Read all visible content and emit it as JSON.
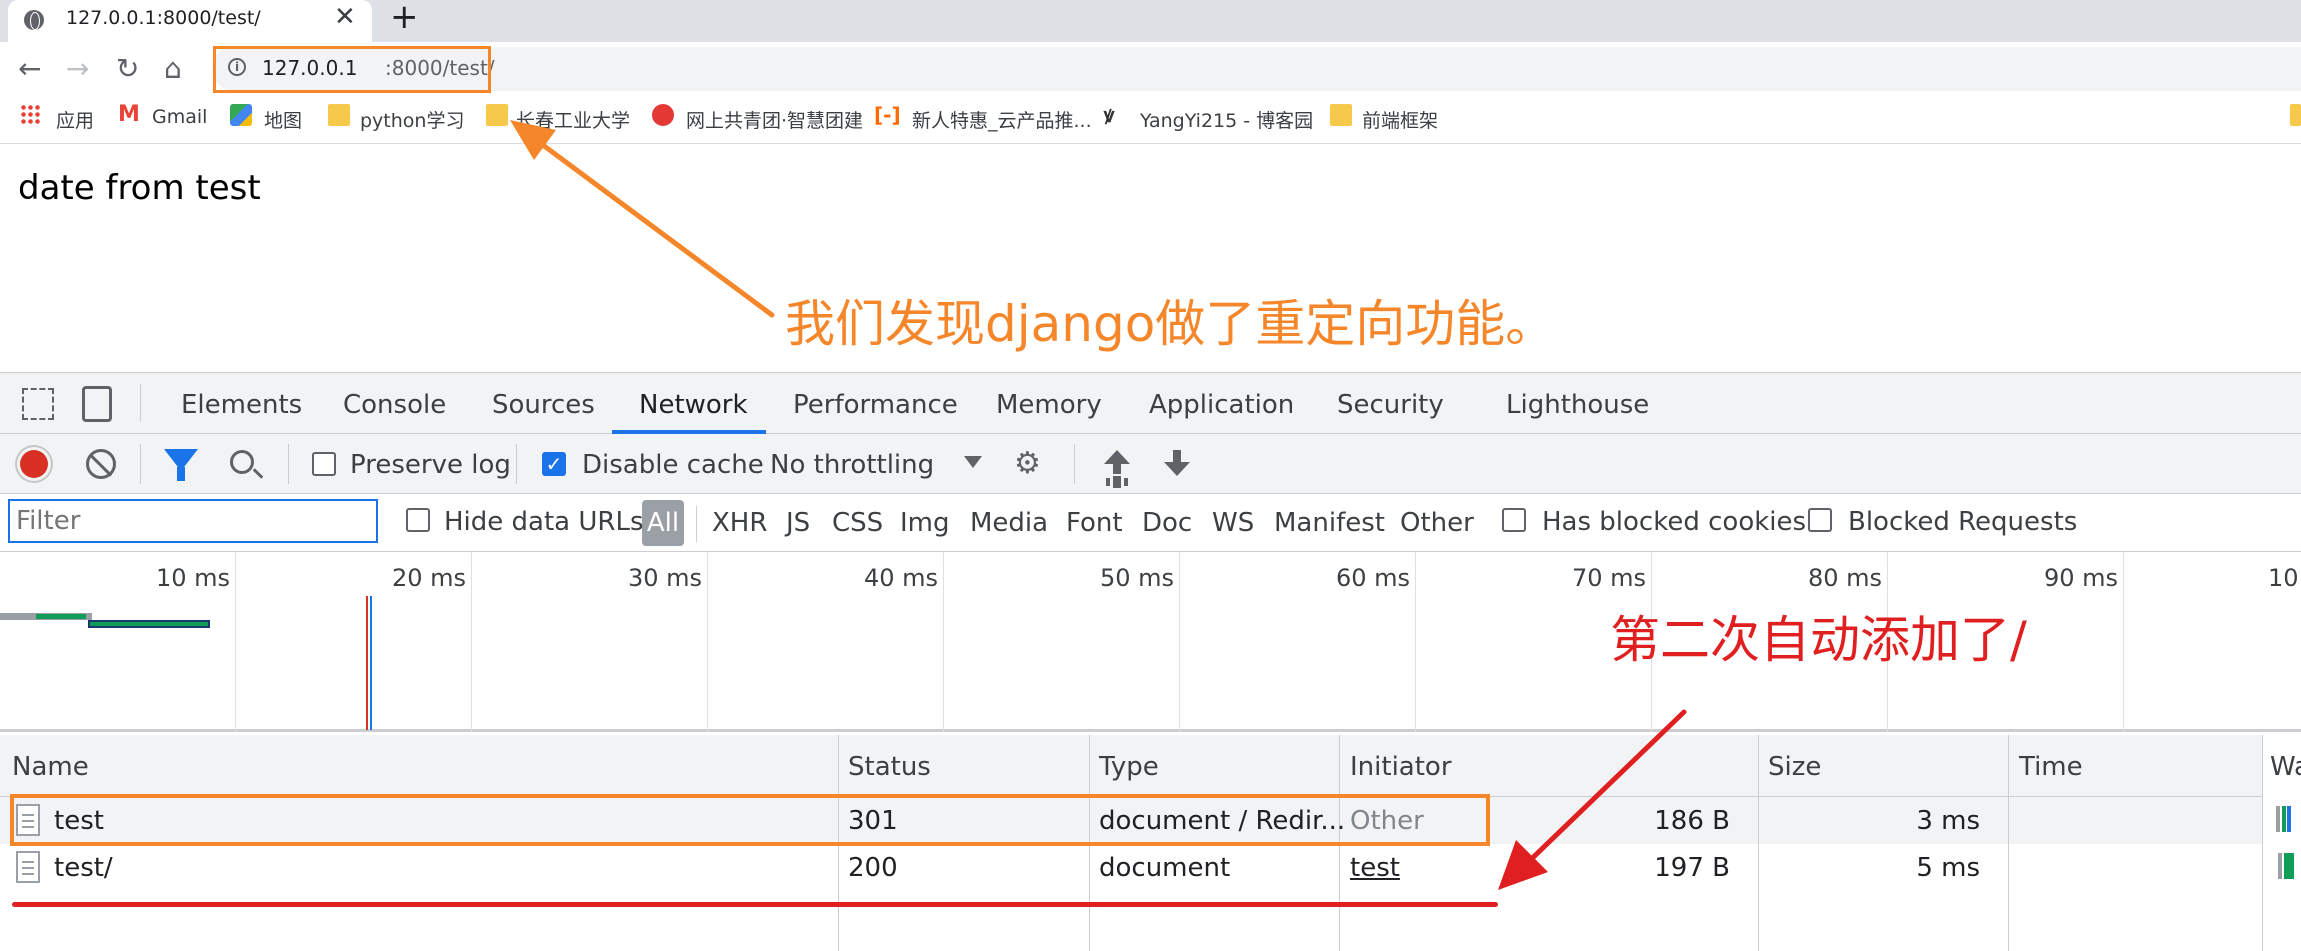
{
  "browser": {
    "tab_title": "127.0.0.1:8000/test/",
    "tab_close": "✕",
    "new_tab": "+",
    "nav": {
      "back": "←",
      "forward": "→",
      "reload": "↻",
      "home": "⌂"
    },
    "address": {
      "host": "127.0.0.1",
      "path": ":8000/test/",
      "info": "i"
    }
  },
  "bookmarks": [
    {
      "label": "应用",
      "icon": "apps-icon"
    },
    {
      "label": "Gmail",
      "icon": "gmail-icon"
    },
    {
      "label": "地图",
      "icon": "maps-icon"
    },
    {
      "label": "python学习",
      "icon": "folder-icon"
    },
    {
      "label": "长春工业大学",
      "icon": "folder-icon"
    },
    {
      "label": "网上共青团·智慧团建",
      "icon": "youth-league-icon"
    },
    {
      "label": "新人特惠_云产品推...",
      "icon": "aliyun-icon"
    },
    {
      "label": "YangYi215 - 博客园",
      "icon": "cnblogs-icon"
    },
    {
      "label": "前端框架",
      "icon": "folder-icon"
    }
  ],
  "page": {
    "text": "date from test"
  },
  "annotations": {
    "redirect_note": "我们发现django做了重定向功能。",
    "slash_note": "第二次自动添加了/"
  },
  "devtools": {
    "tabs": [
      "Elements",
      "Console",
      "Sources",
      "Network",
      "Performance",
      "Memory",
      "Application",
      "Security",
      "Lighthouse"
    ],
    "active_tab": "Network",
    "toolbar": {
      "preserve_log": "Preserve log",
      "disable_cache": "Disable cache",
      "throttling": "No throttling"
    },
    "filterbar": {
      "filter_placeholder": "Filter",
      "hide_data_urls": "Hide data URLs",
      "types": [
        "All",
        "XHR",
        "JS",
        "CSS",
        "Img",
        "Media",
        "Font",
        "Doc",
        "WS",
        "Manifest",
        "Other"
      ],
      "has_blocked_cookies": "Has blocked cookies",
      "blocked_requests": "Blocked Requests"
    },
    "overview_ticks": [
      "10 ms",
      "20 ms",
      "30 ms",
      "40 ms",
      "50 ms",
      "60 ms",
      "70 ms",
      "80 ms",
      "90 ms",
      "10"
    ],
    "table": {
      "columns": [
        "Name",
        "Status",
        "Type",
        "Initiator",
        "Size",
        "Time",
        "Wa"
      ],
      "rows": [
        {
          "name": "test",
          "status": "301",
          "type": "document / Redir...",
          "initiator": "Other",
          "size": "186 B",
          "time": "3 ms"
        },
        {
          "name": "test/",
          "status": "200",
          "type": "document",
          "initiator": "test",
          "size": "197 B",
          "time": "5 ms"
        }
      ]
    }
  },
  "colors": {
    "annotation_orange": "#f5862a",
    "annotation_red": "#e02020",
    "devtools_blue": "#1a73e8"
  }
}
